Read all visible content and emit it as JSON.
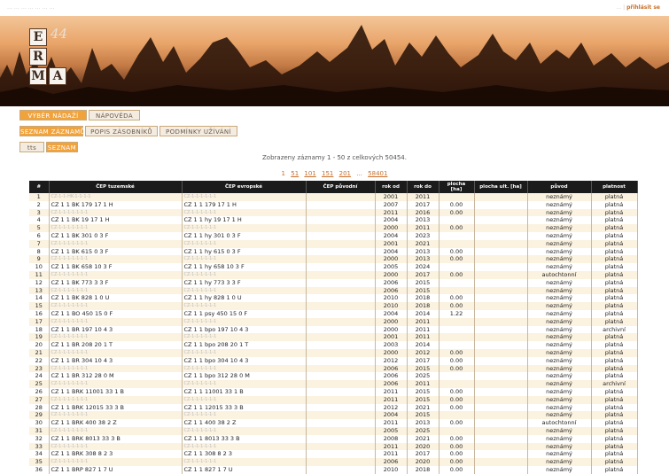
{
  "topbar": {
    "left": "… … … … … … …",
    "right_user": "…",
    "right_link": "přihlásit se"
  },
  "logo": {
    "letters": [
      "E",
      "R",
      "M",
      "A"
    ],
    "number": "44"
  },
  "nav1": [
    {
      "label": "VÝBĚR NÁDAŽÍ",
      "active": true
    },
    {
      "label": "NÁPOVĚDA",
      "active": false
    }
  ],
  "nav2": [
    {
      "label": "SEZNAM ZÁZNAMŮ",
      "active": true
    },
    {
      "label": "POPIS ZÁSOBNÍKŮ",
      "active": false
    },
    {
      "label": "PODMÍNKY UŽÍVÁNÍ",
      "active": false
    }
  ],
  "nav3": [
    {
      "label": "tts",
      "active": false
    },
    {
      "label": "SEZNAM",
      "active": true
    }
  ],
  "summary": "Zobrazeny záznamy 1 - 50 z celkových 50454.",
  "pager": {
    "pages": [
      "1",
      "51",
      "101",
      "151",
      "201"
    ],
    "sep": "...",
    "last": "58401"
  },
  "table": {
    "headers": [
      "#",
      "ČEP tuzemské",
      "ČEP evropské",
      "ČEP původní",
      "rok od",
      "rok do",
      "plocha [ha]",
      "plocha ult. [ha]",
      "původ",
      "platnost"
    ],
    "rows": [
      [
        "1",
        "CZ-1-1-HK-1-1-1-1",
        "CZ-1-1-1-1-1-1",
        "",
        "2001",
        "2011",
        "",
        "",
        "neznámý",
        "platná"
      ],
      [
        "2",
        "CZ 1 1 BK 179 17 1 H",
        "CZ 1 1 179 17 1 H",
        "",
        "2007",
        "2017",
        "0.00",
        "",
        "neznámý",
        "platná"
      ],
      [
        "3",
        "CZ-1-1-1-1-1-1-1",
        "CZ-1-1-1-1-1-1",
        "",
        "2011",
        "2016",
        "0.00",
        "",
        "neznámý",
        "platná"
      ],
      [
        "4",
        "CZ 1 1 BK 19 17 1 H",
        "CZ 1 1 hy 19 17 1 H",
        "",
        "2004",
        "2013",
        "",
        "",
        "neznámý",
        "platná"
      ],
      [
        "5",
        "CZ-1-1-1-1-1-1-1",
        "CZ-1-1-1-1-1-1",
        "",
        "2000",
        "2011",
        "0.00",
        "",
        "neznámý",
        "platná"
      ],
      [
        "6",
        "CZ 1 1 BK 301 0 3 F",
        "CZ 1 1 hy 301 0 3 F",
        "",
        "2004",
        "2023",
        "",
        "",
        "neznámý",
        "platná"
      ],
      [
        "7",
        "CZ-1-1-1-1-1-1-1",
        "CZ-1-1-1-1-1-1",
        "",
        "2001",
        "2021",
        "",
        "",
        "neznámý",
        "platná"
      ],
      [
        "8",
        "CZ 1 1 BK 615 0 3 F",
        "CZ 1 1 hy 615 0 3 F",
        "",
        "2004",
        "2013",
        "0.00",
        "",
        "neznámý",
        "platná"
      ],
      [
        "9",
        "CZ-1-1-1-1-1-1-1",
        "CZ-1-1-1-1-1-1",
        "",
        "2000",
        "2013",
        "0.00",
        "",
        "neznámý",
        "platná"
      ],
      [
        "10",
        "CZ 1 1 BK 658 10 3 F",
        "CZ 1 1 hy 658 10 3 F",
        "",
        "2005",
        "2024",
        "",
        "",
        "neznámý",
        "platná"
      ],
      [
        "11",
        "CZ-1-1-1-1-1-1-1",
        "CZ-1-1-1-1-1-1",
        "",
        "2000",
        "2017",
        "0.00",
        "",
        "autochtonní",
        "platná"
      ],
      [
        "12",
        "CZ 1 1 BK 773 3 3 F",
        "CZ 1 1 hy 773 3 3 F",
        "",
        "2006",
        "2015",
        "",
        "",
        "neznámý",
        "platná"
      ],
      [
        "13",
        "CZ-1-1-1-1-1-1-1",
        "CZ-1-1-1-1-1-1",
        "",
        "2006",
        "2015",
        "",
        "",
        "neznámý",
        "platná"
      ],
      [
        "14",
        "CZ 1 1 BK 828 1 0 U",
        "CZ 1 1 hy 828 1 0 U",
        "",
        "2010",
        "2018",
        "0.00",
        "",
        "neznámý",
        "platná"
      ],
      [
        "15",
        "CZ-1-1-1-1-1-1-1",
        "CZ-1-1-1-1-1-1",
        "",
        "2010",
        "2018",
        "0.00",
        "",
        "neznámý",
        "platná"
      ],
      [
        "16",
        "CZ 1 1 BO 450 15 0 F",
        "CZ 1 1 psy 450 15 0 F",
        "",
        "2004",
        "2014",
        "1.22",
        "",
        "neznámý",
        "platná"
      ],
      [
        "17",
        "CZ-1-1-1-1-1-1-1",
        "CZ-1-1-1-1-1-1",
        "",
        "2000",
        "2011",
        "",
        "",
        "neznámý",
        "platná"
      ],
      [
        "18",
        "CZ 1 1 BR 197 10 4 3",
        "CZ 1 1 bpo 197 10 4 3",
        "",
        "2000",
        "2011",
        "",
        "",
        "neznámý",
        "archivní"
      ],
      [
        "19",
        "CZ-1-1-1-1-1-1-1",
        "CZ-1-1-1-1-1-1",
        "",
        "2001",
        "2011",
        "",
        "",
        "neznámý",
        "platná"
      ],
      [
        "20",
        "CZ 1 1 BR 208 20 1 T",
        "CZ 1 1 bpo 208 20 1 T",
        "",
        "2003",
        "2014",
        "",
        "",
        "neznámý",
        "platná"
      ],
      [
        "21",
        "CZ-1-1-1-1-1-1-1",
        "CZ-1-1-1-1-1-1",
        "",
        "2000",
        "2012",
        "0.00",
        "",
        "neznámý",
        "platná"
      ],
      [
        "22",
        "CZ 1 1 BR 304 10 4 3",
        "CZ 1 1 bpo 304 10 4 3",
        "",
        "2012",
        "2017",
        "0.00",
        "",
        "neznámý",
        "platná"
      ],
      [
        "23",
        "CZ-1-1-1-1-1-1-1",
        "CZ-1-1-1-1-1-1",
        "",
        "2006",
        "2015",
        "0.00",
        "",
        "neznámý",
        "platná"
      ],
      [
        "24",
        "CZ 1 1 BR 312 28 0 M",
        "CZ 1 1 bpo 312 28 0 M",
        "",
        "2006",
        "2025",
        "",
        "",
        "neznámý",
        "platná"
      ],
      [
        "25",
        "CZ-1-1-1-1-1-1-1",
        "CZ-1-1-1-1-1-1",
        "",
        "2006",
        "2011",
        "",
        "",
        "neznámý",
        "archivní"
      ],
      [
        "26",
        "CZ 1 1 BRK 11001 33 1 B",
        "CZ 1 1 11001 33 1 B",
        "",
        "2011",
        "2015",
        "0.00",
        "",
        "neznámý",
        "platná"
      ],
      [
        "27",
        "CZ-1-1-1-1-1-1-1",
        "CZ-1-1-1-1-1-1",
        "",
        "2011",
        "2015",
        "0.00",
        "",
        "neznámý",
        "platná"
      ],
      [
        "28",
        "CZ 1 1 BRK 12015 33 3 B",
        "CZ 1 1 12015 33 3 B",
        "",
        "2012",
        "2021",
        "0.00",
        "",
        "neznámý",
        "platná"
      ],
      [
        "29",
        "CZ-1-1-1-1-1-1-1",
        "CZ-1-1-1-1-1-1",
        "",
        "2004",
        "2015",
        "",
        "",
        "neznámý",
        "platná"
      ],
      [
        "30",
        "CZ 1 1 BRK 400 38 2 Z",
        "CZ 1 1 400 38 2 Z",
        "",
        "2011",
        "2013",
        "0.00",
        "",
        "autochtonní",
        "platná"
      ],
      [
        "31",
        "CZ-1-1-1-1-1-1-1",
        "CZ-1-1-1-1-1-1",
        "",
        "2005",
        "2025",
        "",
        "",
        "neznámý",
        "platná"
      ],
      [
        "32",
        "CZ 1 1 BRK 8013 33 3 B",
        "CZ 1 1 8013 33 3 B",
        "",
        "2008",
        "2021",
        "0.00",
        "",
        "neznámý",
        "platná"
      ],
      [
        "33",
        "CZ-1-1-1-1-1-1-1",
        "CZ-1-1-1-1-1-1",
        "",
        "2011",
        "2020",
        "0.00",
        "",
        "neznámý",
        "platná"
      ],
      [
        "34",
        "CZ 1 1 BRK 308 8 2 3",
        "CZ 1 1 308 8 2 3",
        "",
        "2011",
        "2017",
        "0.00",
        "",
        "neznámý",
        "platná"
      ],
      [
        "35",
        "CZ-1-1-1-1-1-1-1",
        "CZ-1-1-1-1-1-1",
        "",
        "2006",
        "2020",
        "0.00",
        "",
        "neznámý",
        "platná"
      ],
      [
        "36",
        "CZ 1 1 BRP 827 1 7 U",
        "CZ 1 1 827 1 7 U",
        "",
        "2010",
        "2018",
        "0.00",
        "",
        "neznámý",
        "platná"
      ]
    ]
  }
}
